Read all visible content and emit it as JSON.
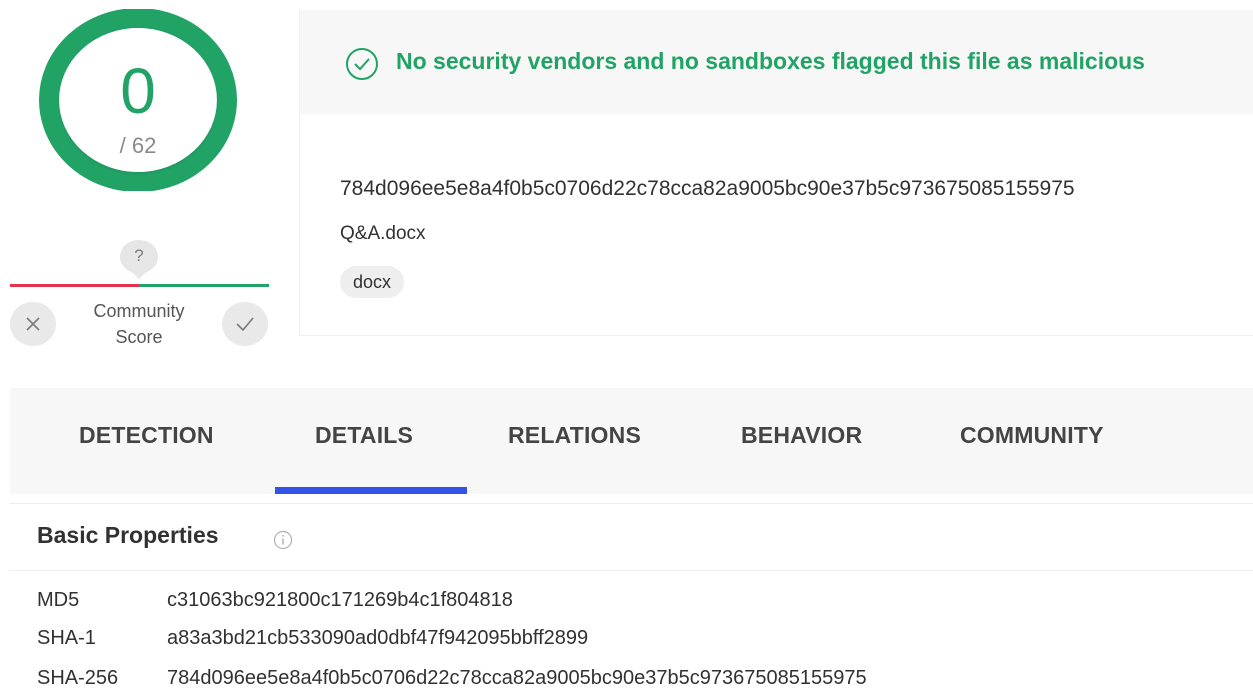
{
  "detection_score": {
    "positives": "0",
    "total": "/ 62"
  },
  "community_score": {
    "question_mark": "?",
    "label_line1": "Community",
    "label_line2": "Score",
    "vote_bad_icon": "close-icon",
    "vote_good_icon": "check-icon"
  },
  "summary": {
    "banner_text": "No security vendors and no sandboxes flagged this file as malicious",
    "file_hash": "784d096ee5e8a4f0b5c0706d22c78cca82a9005bc90e37b5c973675085155975",
    "file_name": "Q&A.docx",
    "tag": "docx"
  },
  "tabs": [
    {
      "label": "DETECTION"
    },
    {
      "label": "DETAILS",
      "active": true
    },
    {
      "label": "RELATIONS"
    },
    {
      "label": "BEHAVIOR"
    },
    {
      "label": "COMMUNITY"
    }
  ],
  "basic_properties": {
    "title": "Basic Properties",
    "rows": [
      {
        "label": "MD5",
        "value": "c31063bc921800c171269b4c1f804818"
      },
      {
        "label": "SHA-1",
        "value": "a83a3bd21cb533090ad0dbf47f942095bbff2899"
      },
      {
        "label": "SHA-256",
        "value": "784d096ee5e8a4f0b5c0706d22c78cca82a9005bc90e37b5c973675085155975"
      }
    ]
  },
  "colors": {
    "clean_green": "#21a366",
    "malicious_red": "#e6334d",
    "tab_accent": "#3352e8"
  }
}
